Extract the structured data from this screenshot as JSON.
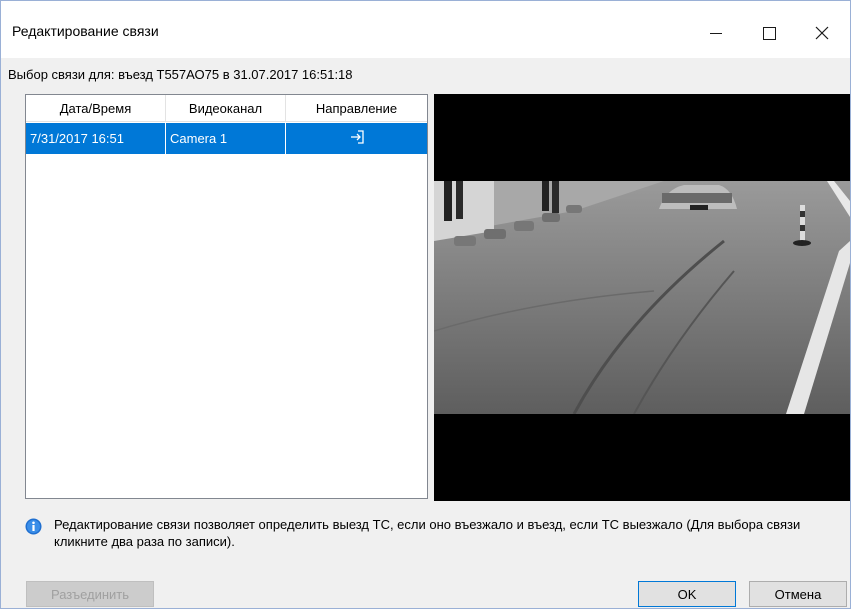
{
  "window": {
    "title": "Редактирование связи",
    "subtitle": "Выбор связи для: въезд Т557АО75 в 31.07.2017 16:51:18"
  },
  "list": {
    "headers": [
      "Дата/Время",
      "Видеоканал",
      "Направление"
    ],
    "rows": [
      {
        "datetime": "7/31/2017 16:51",
        "channel": "Camera 1",
        "direction_icon": "enter-icon"
      }
    ]
  },
  "video": {
    "content": "grayscale-parking-camera-frame"
  },
  "info": {
    "icon": "info-icon",
    "text": "Редактирование связи позволяет определить выезд ТС, если оно въезжало и въезд, если ТС выезжало (Для выбора связи кликните два раза по записи)."
  },
  "buttons": {
    "disconnect": "Разъединить",
    "ok": "OK",
    "cancel": "Отмена"
  },
  "colors": {
    "selection": "#0078d7",
    "accent": "#0078d7"
  }
}
